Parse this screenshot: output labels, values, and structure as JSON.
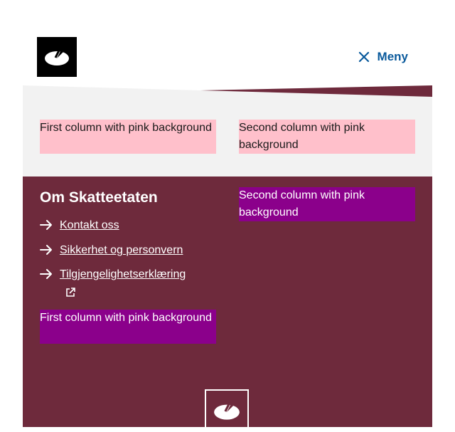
{
  "header": {
    "logo_icon": "skatteetaten-logo-icon",
    "menu_label": "Meny",
    "menu_icon": "close-icon",
    "accent": "#0a5a9c"
  },
  "content": {
    "first_column": "First column with pink background",
    "second_column": "Second column with pink background"
  },
  "footer": {
    "title": "Om Skatteetaten",
    "links": [
      {
        "label": "Kontakt oss",
        "icon": "arrow-right-icon"
      },
      {
        "label": "Sikkerhet og personvern",
        "icon": "arrow-right-icon"
      },
      {
        "label": "Tilgjengelighetserklæring",
        "icon": "arrow-right-icon",
        "external": true
      }
    ],
    "first_column": "First column with pink background",
    "second_column": "Second column with pink background",
    "background": "#6e2a3c",
    "column_color": "#8b008b"
  }
}
